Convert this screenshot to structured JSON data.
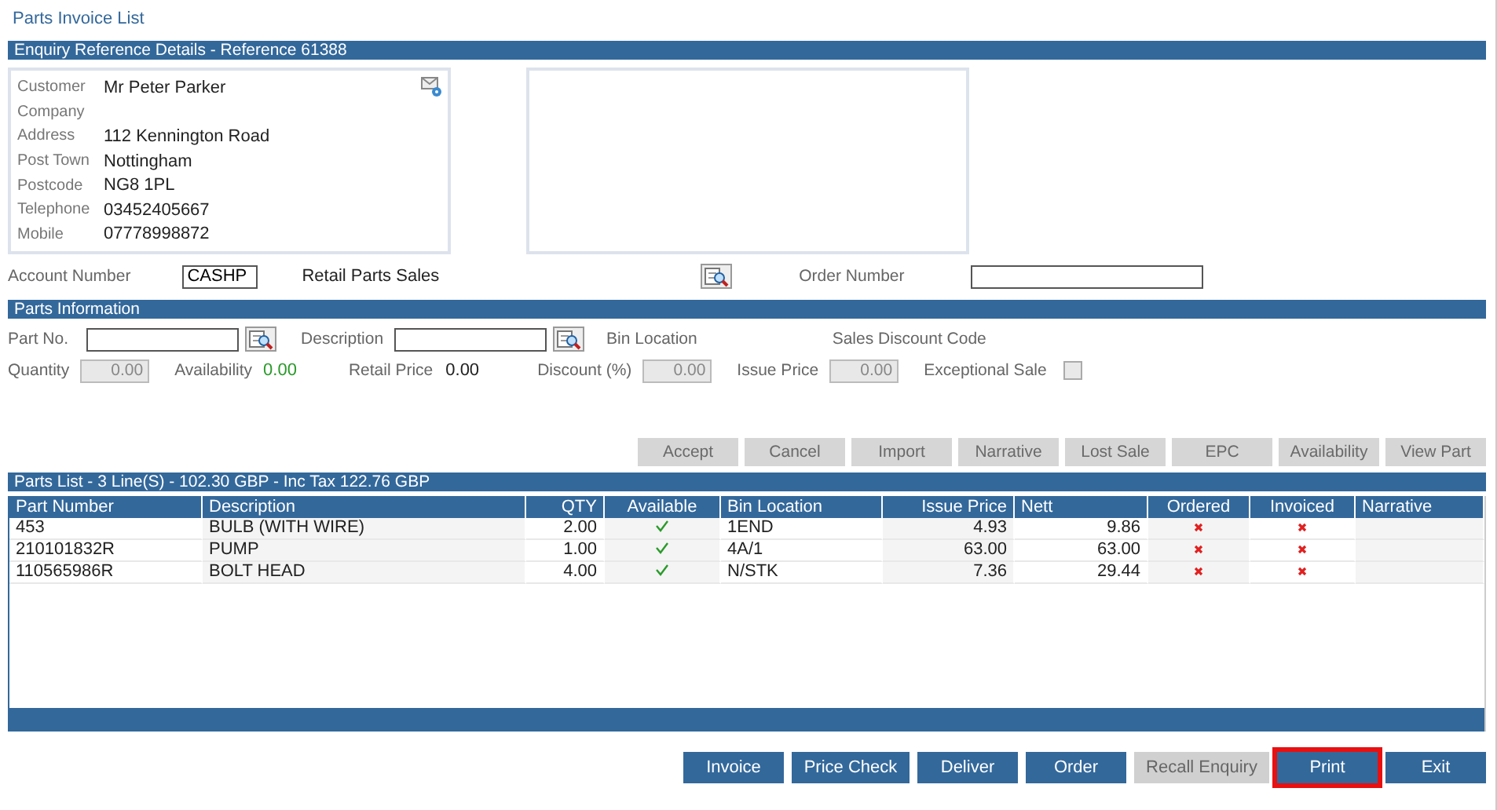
{
  "window": {
    "title": "Parts Invoice List"
  },
  "enquiry": {
    "header": "Enquiry Reference Details  -  Reference 61388",
    "customer_fields": [
      {
        "label": "Customer",
        "value": "Mr Peter Parker"
      },
      {
        "label": "Company"
      },
      {
        "label": "Address",
        "value": "112 Kennington Road"
      },
      {
        "label": "Post Town",
        "value": "Nottingham"
      },
      {
        "label": "Postcode",
        "value": "NG8 1PL"
      },
      {
        "label": "Telephone",
        "value": "03452405667"
      },
      {
        "label": "Mobile",
        "value": "07778998872"
      }
    ],
    "account_label": "Account Number",
    "account_value": "CASHP",
    "account_name": "Retail Parts Sales",
    "order_label": "Order Number"
  },
  "parts_info": {
    "header": "Parts Information",
    "part_no_label": "Part No.",
    "description_label": "Description",
    "bin_location_label": "Bin Location",
    "sales_discount_label": "Sales Discount Code",
    "quantity_label": "Quantity",
    "quantity_value": "0.00",
    "availability_label": "Availability",
    "availability_value": "0.00",
    "retail_price_label": "Retail Price",
    "retail_price_value": "0.00",
    "discount_label": "Discount (%)",
    "discount_value": "0.00",
    "issue_price_label": "Issue Price",
    "issue_price_value": "0.00",
    "exceptional_sale_label": "Exceptional Sale",
    "exceptional_sale_checked": false,
    "buttons": [
      {
        "label": "Accept",
        "disabled": true
      },
      {
        "label": "Cancel",
        "disabled": true
      },
      {
        "label": "Import",
        "disabled": true
      },
      {
        "label": "Narrative",
        "disabled": true
      },
      {
        "label": "Lost Sale",
        "disabled": true
      },
      {
        "label": "EPC",
        "disabled": true
      },
      {
        "label": "Availability",
        "disabled": true
      },
      {
        "label": "View Part",
        "disabled": true
      }
    ]
  },
  "parts_list": {
    "header": "Parts List - 3 Line(S) - 102.30 GBP - Inc Tax 122.76 GBP",
    "columns": [
      {
        "label": "Part Number"
      },
      {
        "label": "Description"
      },
      {
        "label": "QTY"
      },
      {
        "label": "Available"
      },
      {
        "label": "Bin Location"
      },
      {
        "label": "Issue Price"
      },
      {
        "label": "Nett"
      },
      {
        "label": "Ordered"
      },
      {
        "label": "Invoiced"
      },
      {
        "label": "Narrative"
      }
    ],
    "rows": [
      {
        "part_number": "453",
        "description": "BULB (WITH WIRE)",
        "qty": "2.00",
        "available": true,
        "bin_location": "1END",
        "issue_price": "4.93",
        "nett": "9.86",
        "ordered": false,
        "invoiced": false
      },
      {
        "part_number": "210101832R",
        "description": "PUMP",
        "qty": "1.00",
        "available": true,
        "bin_location": "4A/1",
        "issue_price": "63.00",
        "nett": "63.00",
        "ordered": false,
        "invoiced": false
      },
      {
        "part_number": "110565986R",
        "description": "BOLT HEAD",
        "qty": "4.00",
        "available": true,
        "bin_location": "N/STK",
        "issue_price": "7.36",
        "nett": "29.44",
        "ordered": false,
        "invoiced": false
      }
    ]
  },
  "footer_buttons": [
    {
      "label": "Invoice",
      "disabled": false,
      "highlighted": false
    },
    {
      "label": "Price Check",
      "disabled": false,
      "highlighted": false
    },
    {
      "label": "Deliver",
      "disabled": false,
      "highlighted": false
    },
    {
      "label": "Order",
      "disabled": false,
      "highlighted": false
    },
    {
      "label": "Recall Enquiry",
      "disabled": true,
      "highlighted": false
    },
    {
      "label": "Print",
      "disabled": false,
      "highlighted": true
    },
    {
      "label": "Exit",
      "disabled": false,
      "highlighted": false
    }
  ]
}
